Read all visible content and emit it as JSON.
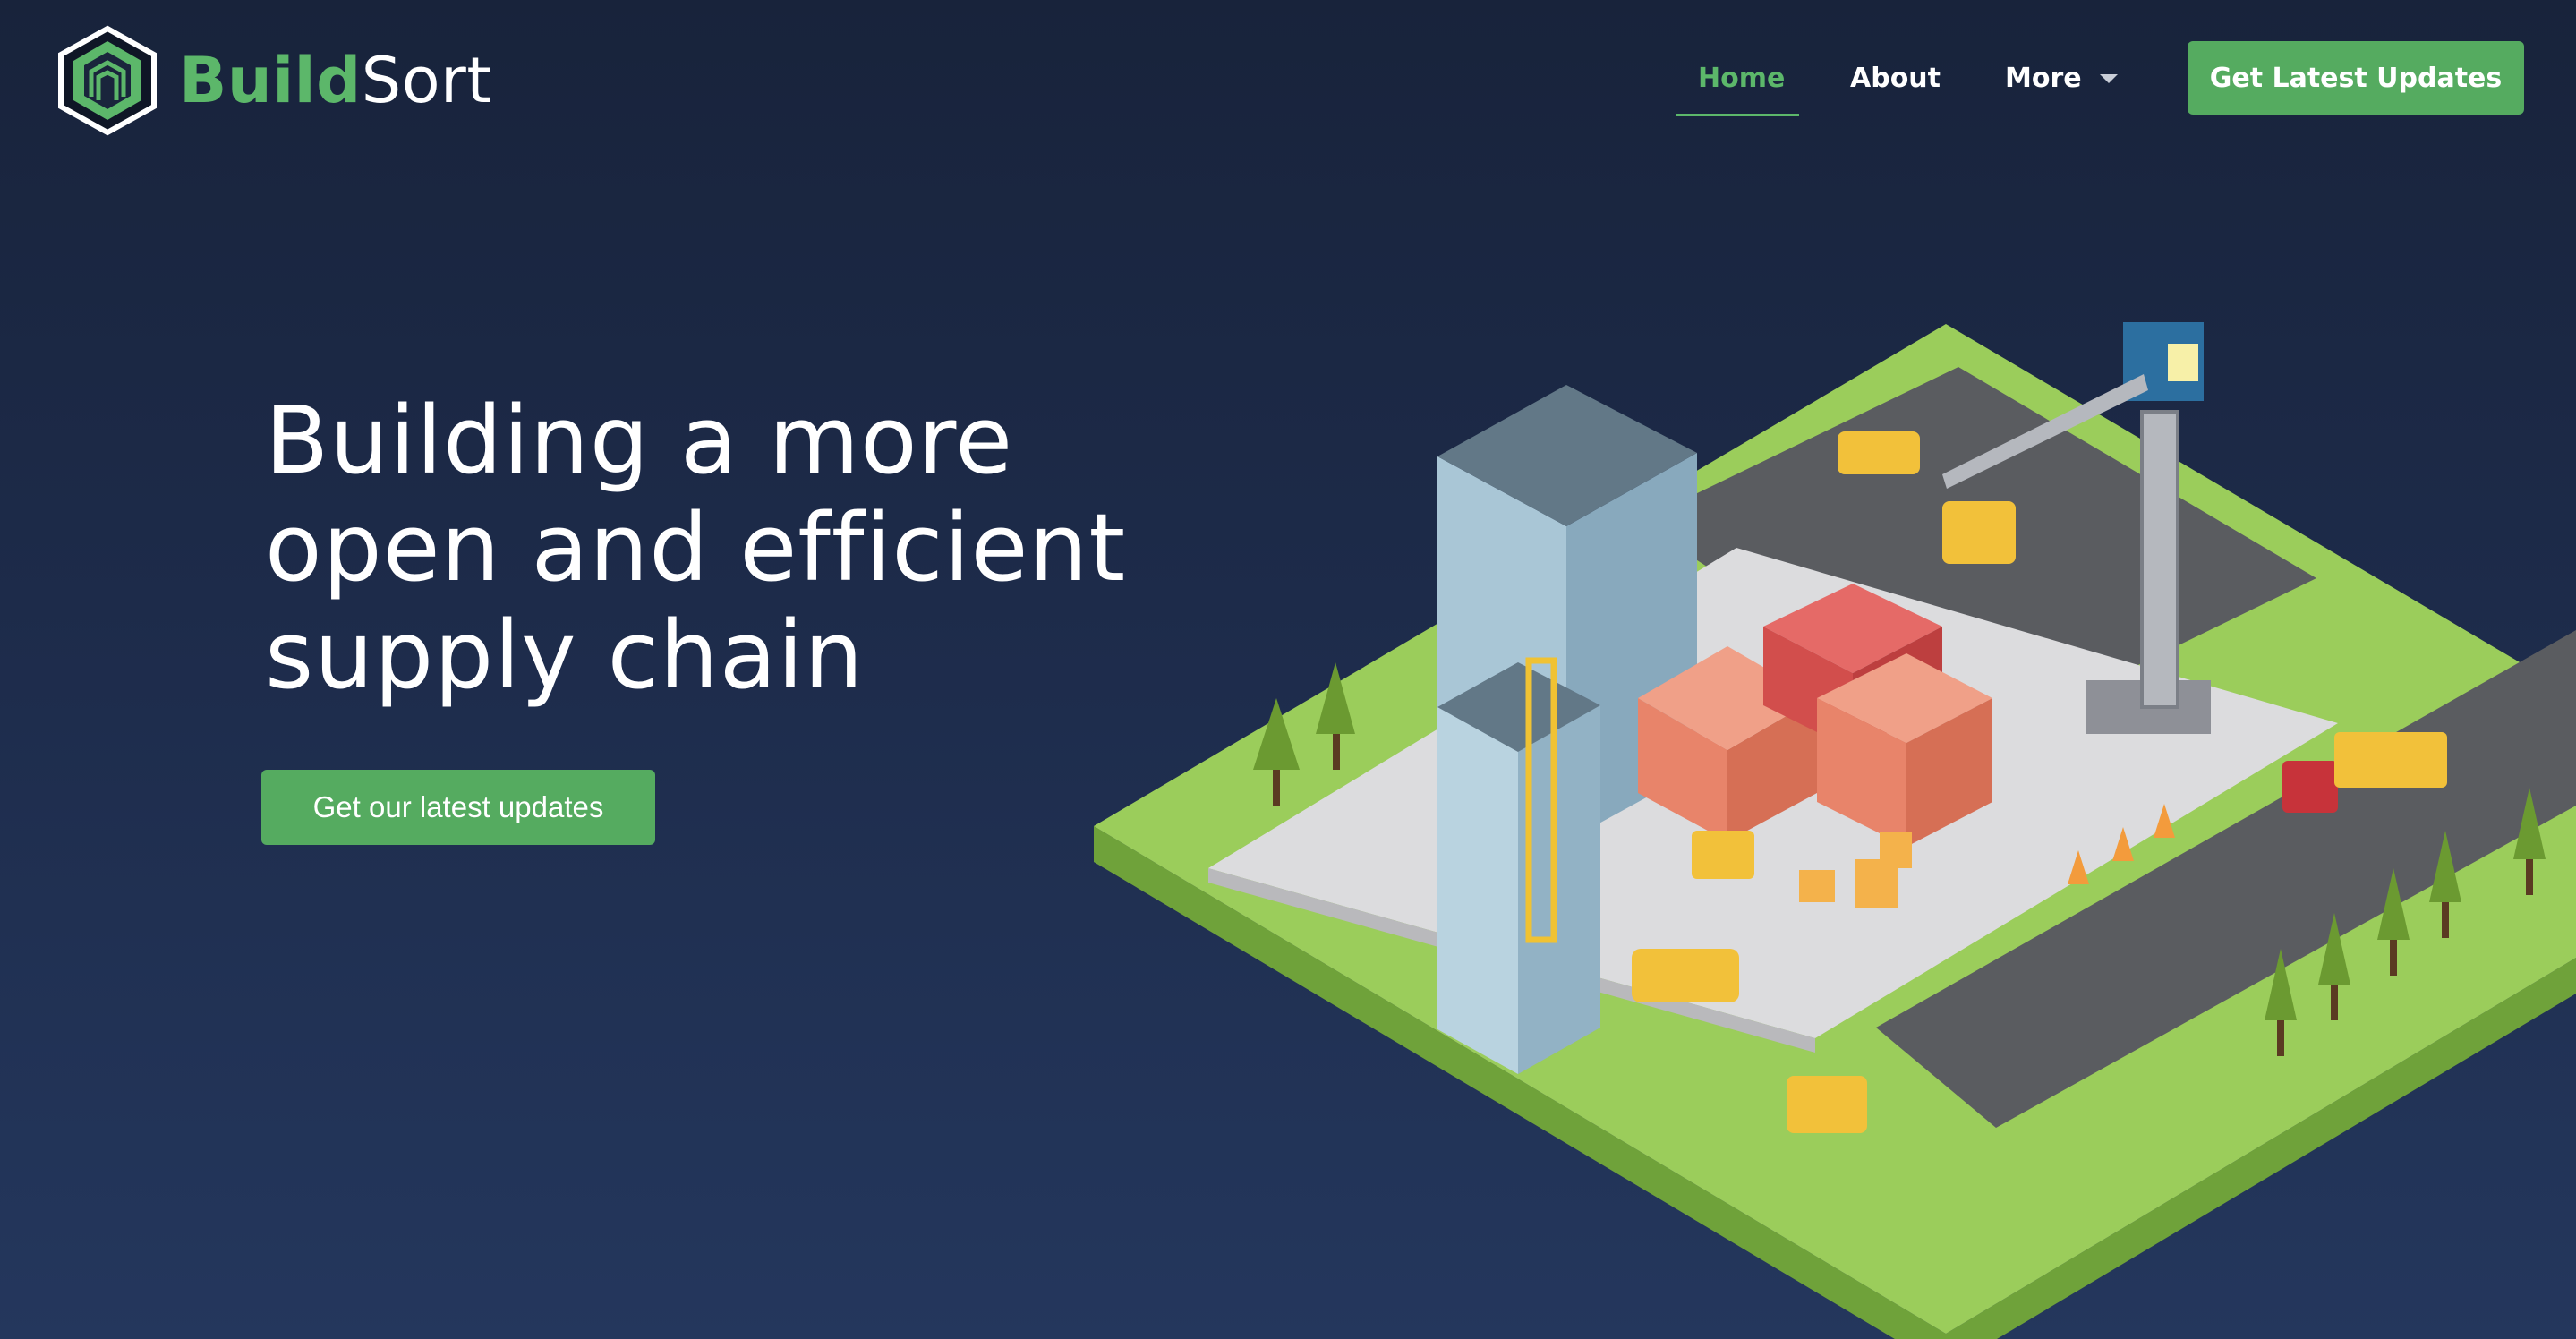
{
  "brand": {
    "name_bold": "Build",
    "name_light": "Sort",
    "logo_icon": "hexagon-building-logo"
  },
  "nav": {
    "home": "Home",
    "about": "About",
    "more": "More",
    "cta": "Get Latest Updates"
  },
  "hero": {
    "title_line1": "Building a more",
    "title_line2": "open and efficient",
    "title_line3": "supply chain",
    "button": "Get our latest updates"
  },
  "colors": {
    "accent_green": "#55ab60",
    "background_top": "#18233b",
    "background_bottom": "#24375d"
  },
  "illustration": "isometric-construction-site"
}
